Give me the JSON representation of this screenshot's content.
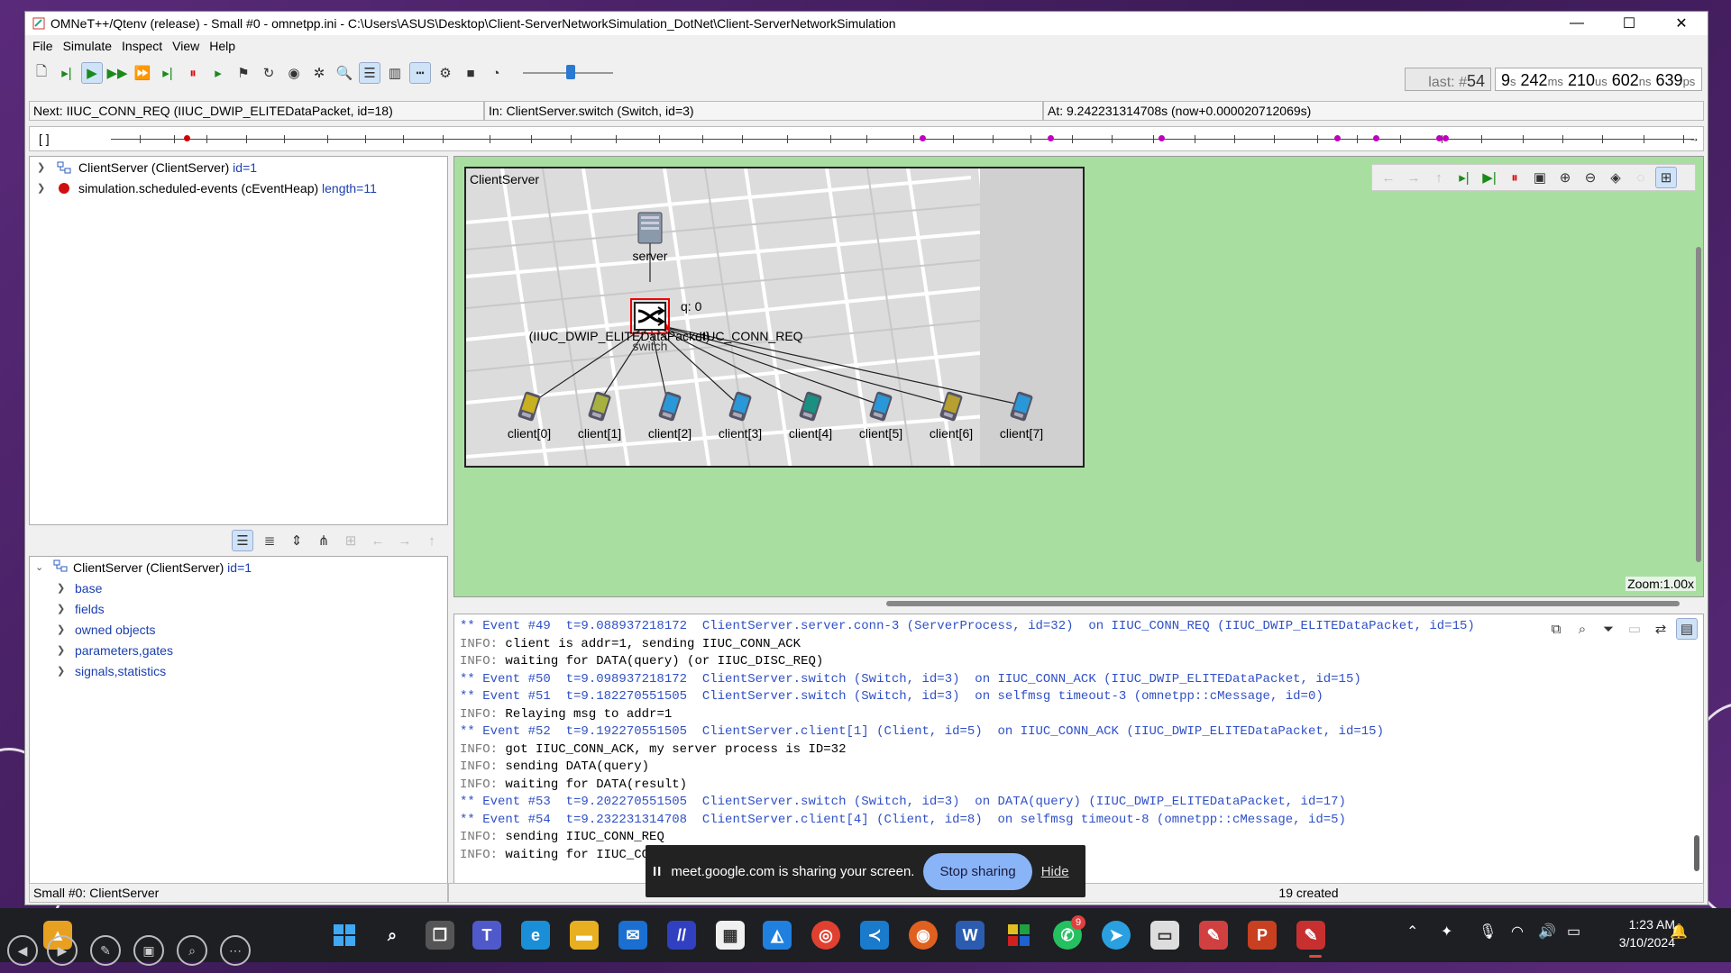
{
  "window": {
    "title": "OMNeT++/Qtenv (release) - Small #0 - omnetpp.ini - C:\\Users\\ASUS\\Desktop\\Client-ServerNetworkSimulation_DotNet\\Client-ServerNetworkSimulation",
    "minimize": "—",
    "maximize": "☐",
    "close": "✕"
  },
  "menu": [
    "File",
    "Simulate",
    "Inspect",
    "View",
    "Help"
  ],
  "counter": {
    "prefix": "last: #",
    "value": "54"
  },
  "sim_time": {
    "s": "9",
    "s_unit": "s",
    "ms": "242",
    "ms_unit": "ms",
    "us": "210",
    "us_unit": "us",
    "ns": "602",
    "ns_unit": "ns",
    "ps": "639",
    "ps_unit": "ps"
  },
  "info": {
    "next": "Next: IIUC_CONN_REQ (IIUC_DWIP_ELITEDataPacket, id=18)",
    "in": "In: ClientServer.switch (Switch, id=3)",
    "at": "At: 9.242231314708s (now+0.000020712069s)"
  },
  "timeline": {
    "brackets": "[   ]"
  },
  "tree": [
    {
      "label": "ClientServer (ClientServer)",
      "extra": "id=1"
    },
    {
      "label": "simulation.scheduled-events (cEventHeap)",
      "extra": "length=11"
    }
  ],
  "object": {
    "root_label": "ClientServer (ClientServer)",
    "root_extra": "id=1",
    "children": [
      "base",
      "fields",
      "owned objects",
      "parameters,gates",
      "signals,statistics"
    ]
  },
  "network": {
    "title": "ClientServer",
    "server": "server",
    "switch": "switch",
    "queue": "q: 0",
    "msg_left": "(IIUC_DWIP_ELITEDataPacket)",
    "msg_right": "IIUC_CONN_REQ",
    "clients": [
      "client[0]",
      "client[1]",
      "client[2]",
      "client[3]",
      "client[4]",
      "client[5]",
      "client[6]",
      "client[7]"
    ]
  },
  "zoom": "Zoom:1.00x",
  "log": [
    {
      "type": "ev",
      "text": "** Event #49  t=9.088937218172  ClientServer.server.conn-3 (ServerProcess, id=32)  on IIUC_CONN_REQ (IIUC_DWIP_ELITEDataPacket, id=15)"
    },
    {
      "type": "info",
      "prefix": "INFO: ",
      "text": "client is addr=1, sending IIUC_CONN_ACK"
    },
    {
      "type": "info",
      "prefix": "INFO: ",
      "text": "waiting for DATA(query) (or IIUC_DISC_REQ)"
    },
    {
      "type": "ev",
      "text": "** Event #50  t=9.098937218172  ClientServer.switch (Switch, id=3)  on IIUC_CONN_ACK (IIUC_DWIP_ELITEDataPacket, id=15)"
    },
    {
      "type": "ev",
      "text": "** Event #51  t=9.182270551505  ClientServer.switch (Switch, id=3)  on selfmsg timeout-3 (omnetpp::cMessage, id=0)"
    },
    {
      "type": "info",
      "prefix": "INFO: ",
      "text": "Relaying msg to addr=1"
    },
    {
      "type": "ev",
      "text": "** Event #52  t=9.192270551505  ClientServer.client[1] (Client, id=5)  on IIUC_CONN_ACK (IIUC_DWIP_ELITEDataPacket, id=15)"
    },
    {
      "type": "info",
      "prefix": "INFO: ",
      "text": "got IIUC_CONN_ACK, my server process is ID=32"
    },
    {
      "type": "info",
      "prefix": "INFO: ",
      "text": "sending DATA(query)"
    },
    {
      "type": "info",
      "prefix": "INFO: ",
      "text": "waiting for DATA(result)"
    },
    {
      "type": "ev",
      "text": "** Event #53  t=9.202270551505  ClientServer.switch (Switch, id=3)  on DATA(query) (IIUC_DWIP_ELITEDataPacket, id=17)"
    },
    {
      "type": "ev",
      "text": "** Event #54  t=9.232231314708  ClientServer.client[4] (Client, id=8)  on selfmsg timeout-8 (omnetpp::cMessage, id=5)"
    },
    {
      "type": "info",
      "prefix": "INFO: ",
      "text": "sending IIUC_CONN_REQ"
    },
    {
      "type": "info",
      "prefix": "INFO: ",
      "text": "waiting for IIUC_CONN_ACK"
    }
  ],
  "status": {
    "left": "Small #0: ClientServer",
    "right": "19 created"
  },
  "meet": {
    "pause": "II",
    "message": "meet.google.com is sharing your screen.",
    "stop": "Stop sharing",
    "hide": "Hide"
  },
  "taskbar": {
    "time": "1:23 AM",
    "date": "3/10/2024",
    "whatsapp_badge": "9"
  },
  "colors": {
    "canvas": "#a8dfa0",
    "log_event": "#3050c8",
    "timeline_marker": "#c000c0",
    "accent": "#2a78d0"
  }
}
